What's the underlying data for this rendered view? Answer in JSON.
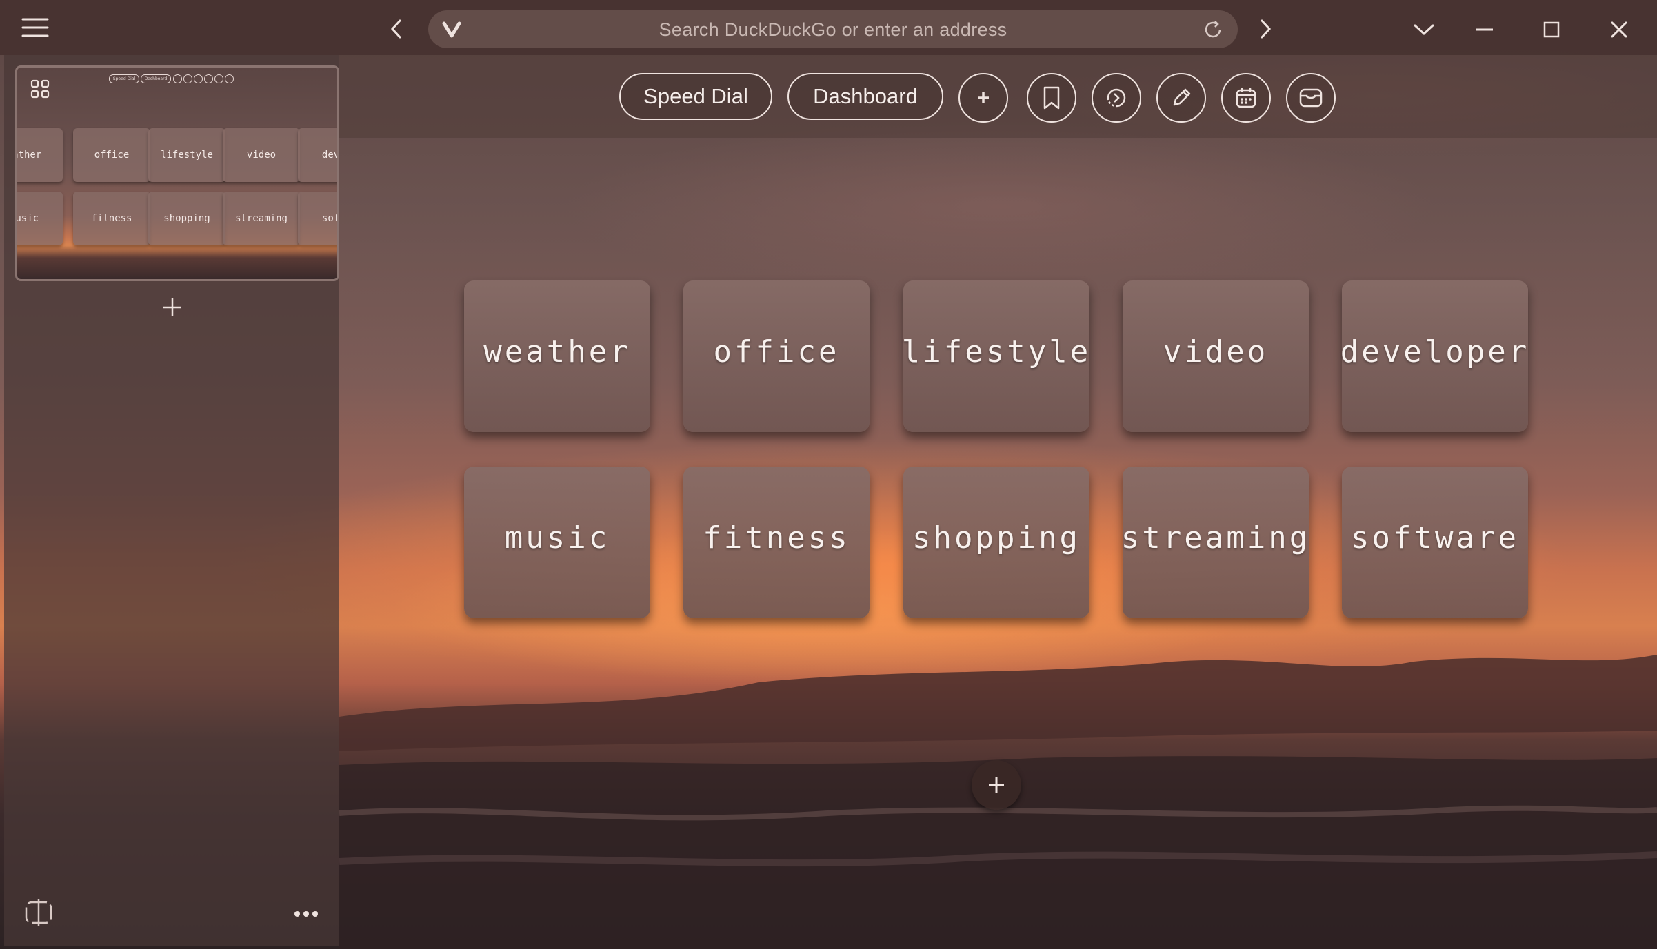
{
  "browser": {
    "menu_icon": "hamburger-icon",
    "address_placeholder": "Search DuckDuckGo or enter an address",
    "search_engine_icon": "vivaldi-v-icon"
  },
  "toolbar": {
    "speed_dial_label": "Speed Dial",
    "dashboard_label": "Dashboard",
    "icons": [
      "plus-icon",
      "bookmark-icon",
      "history-icon",
      "notes-pencil-icon",
      "calendar-icon",
      "mail-icon"
    ]
  },
  "sidebar": {
    "thumbnail_tiles": [
      "eather",
      "office",
      "lifestyle",
      "video",
      "devel",
      "nusic",
      "fitness",
      "shopping",
      "streaming",
      "softv"
    ],
    "thumbnail_pills": [
      "Speed Dial",
      "Dashboard"
    ]
  },
  "speed_dial": {
    "tiles": [
      "weather",
      "office",
      "lifestyle",
      "video",
      "developer",
      "music",
      "fitness",
      "shopping",
      "streaming",
      "software"
    ]
  },
  "colors": {
    "accent_border": "#efe3df",
    "tile_bg": "#876c67",
    "chrome_bg": "#463230"
  }
}
